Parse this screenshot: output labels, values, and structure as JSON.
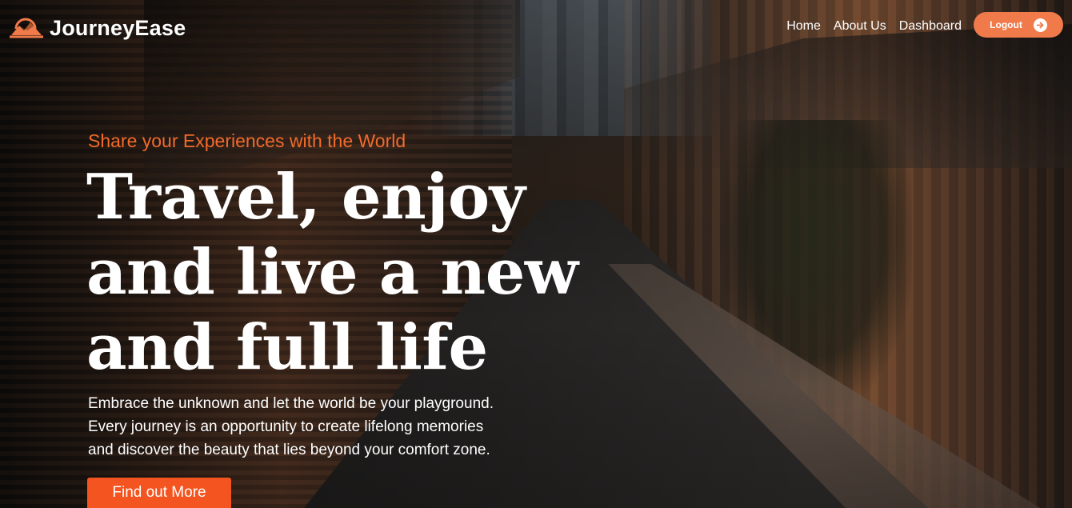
{
  "brand": {
    "name": "JourneyEase",
    "logo_icon": "sunset-mountain-icon"
  },
  "nav": {
    "links": [
      {
        "label": "Home"
      },
      {
        "label": "About Us"
      },
      {
        "label": "Dashboard"
      }
    ],
    "logout_label": "Logout",
    "logout_icon": "arrow-right-circle-icon"
  },
  "hero": {
    "tagline": "Share your Experiences with the World",
    "title_lines": [
      "Travel, enjoy",
      "and live a new",
      "and full life"
    ],
    "description_lines": [
      "Embrace the unknown and let the world be your playground.",
      "Every journey is an opportunity to create lifelong memories",
      "and discover the beauty that lies beyond your comfort zone."
    ],
    "cta_label": "Find out More"
  },
  "colors": {
    "accent": "#f26a2b",
    "button": "#f4541f",
    "logout_button": "#f07a4a",
    "text": "#ffffff"
  }
}
